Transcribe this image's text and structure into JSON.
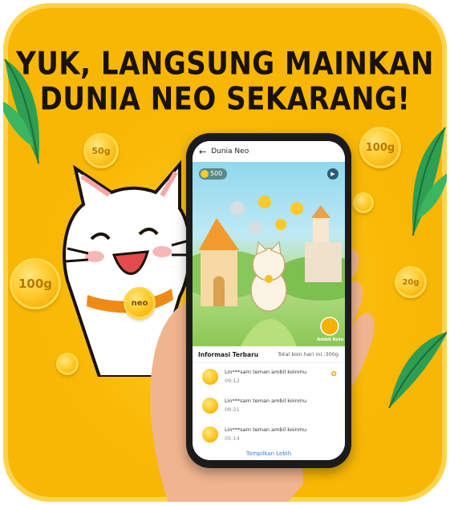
{
  "headline": {
    "line1": "YUK, LANGSUNG MAINKAN",
    "line2": "DUNIA NEO SEKARANG!"
  },
  "coins": {
    "left_big": "100g",
    "left_top": "50g",
    "right_top": "100g",
    "right_mid": "20g"
  },
  "cat_badge": "neo",
  "phone": {
    "header_title": "Dunia Neo",
    "coin_balance": "500",
    "game_label": "Ambil Koin",
    "info_title": "Informasi Terbaru",
    "info_total": "Total koin hari ini :300g",
    "rows": [
      {
        "text": "Lin***sam teman ambil koinmu",
        "time": "09:12"
      },
      {
        "text": "Lin***sam teman ambil koinmu",
        "time": "08:21"
      },
      {
        "text": "Lin***sam teman ambil koinmu",
        "time": "05:14"
      }
    ],
    "show_more": "Tampilkan Lebih"
  }
}
